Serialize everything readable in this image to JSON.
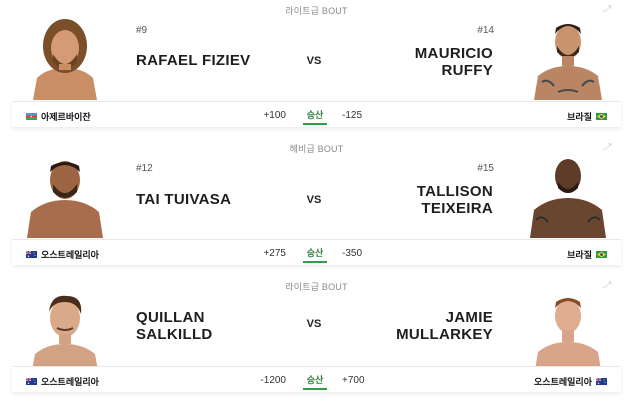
{
  "fights": [
    {
      "weight_class": "라이트급 BOUT",
      "red": {
        "rank": "#9",
        "name_lines": [
          "RAFAEL FIZIEV"
        ],
        "country": "아제르바이잔",
        "odds": "+100",
        "flag": "azerbaijan"
      },
      "blue": {
        "rank": "#14",
        "name_lines": [
          "MAURICIO",
          "RUFFY"
        ],
        "country": "브라질",
        "odds": "-125",
        "flag": "brazil"
      },
      "vs": "VS",
      "result_label": "승산"
    },
    {
      "weight_class": "헤비급 BOUT",
      "red": {
        "rank": "#12",
        "name_lines": [
          "TAI TUIVASA"
        ],
        "country": "오스트레일리아",
        "odds": "+275",
        "flag": "australia"
      },
      "blue": {
        "rank": "#15",
        "name_lines": [
          "TALLISON",
          "TEIXEIRA"
        ],
        "country": "브라질",
        "odds": "-350",
        "flag": "brazil"
      },
      "vs": "VS",
      "result_label": "승산"
    },
    {
      "weight_class": "라이트급 BOUT",
      "red": {
        "rank": "",
        "name_lines": [
          "QUILLAN",
          "SALKILLD"
        ],
        "country": "오스트레일리아",
        "odds": "-1200",
        "flag": "australia"
      },
      "blue": {
        "rank": "",
        "name_lines": [
          "JAMIE",
          "MULLARKEY"
        ],
        "country": "오스트레일리아",
        "odds": "+700",
        "flag": "australia"
      },
      "vs": "VS",
      "result_label": "승산"
    }
  ],
  "icons": {
    "expand": "expand-icon"
  },
  "colors": {
    "win_underline": "#2f9e44",
    "win_text": "#2f7d3b"
  }
}
